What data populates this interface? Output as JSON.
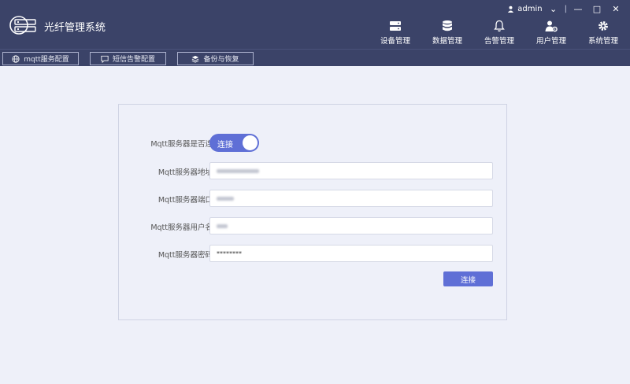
{
  "app": {
    "title": "光纤管理系统"
  },
  "user": {
    "name": "admin"
  },
  "window": {
    "separator": "|",
    "min": "—",
    "max": "□",
    "close": "✕"
  },
  "nav": [
    {
      "label": "设备管理",
      "icon": "server-icon"
    },
    {
      "label": "数据管理",
      "icon": "database-icon"
    },
    {
      "label": "告警管理",
      "icon": "bell-icon"
    },
    {
      "label": "用户管理",
      "icon": "user-settings-icon"
    },
    {
      "label": "系统管理",
      "icon": "gear-icon"
    }
  ],
  "subtabs": [
    {
      "label": "mqtt服务配置",
      "icon": "globe-icon"
    },
    {
      "label": "短信告警配置",
      "icon": "message-icon"
    },
    {
      "label": "备份与恢复",
      "icon": "layers-icon"
    }
  ],
  "form": {
    "connected_label": "Mqtt服务器是否连",
    "toggle_label": "连接",
    "address_label": "Mqtt服务器地址",
    "port_label": "Mqtt服务器端口",
    "username_label": "Mqtt服务器用户名",
    "password_label": "Mqtt服务器密码",
    "password_value": "********",
    "submit_label": "连接"
  },
  "colors": {
    "header_bg": "#3b4368",
    "accent": "#5f6fd6",
    "page_bg": "#eef0f9"
  }
}
